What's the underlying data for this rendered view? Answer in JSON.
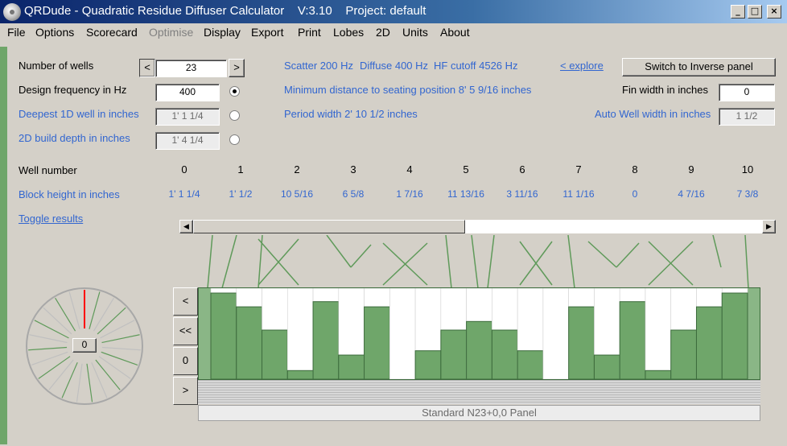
{
  "window": {
    "title": "QRDude - Quadratic Residue Diffuser Calculator    V:3.10    Project: default",
    "controls": [
      "_",
      "□",
      "×"
    ]
  },
  "menu": [
    "File",
    "Options",
    "Scorecard",
    "Optimise",
    "Display",
    "Export",
    "Print",
    "Lobes",
    "2D",
    "Units",
    "About"
  ],
  "menu_disabled": "Optimise",
  "form": {
    "num_wells_label": "Number of wells",
    "num_wells_value": "23",
    "design_freq_label": "Design frequency in Hz",
    "design_freq_value": "400",
    "deepest_label": "Deepest 1D well in inches",
    "deepest_value": "1' 1 1/4",
    "build_depth_label": "2D build depth in inches",
    "build_depth_value": "1' 4 1/4",
    "spin_left": "<",
    "spin_right": ">"
  },
  "info": {
    "scatter": "Scatter 200 Hz",
    "diffuse": "Diffuse 400 Hz",
    "hf_cutoff": "HF cutoff 4526 Hz",
    "explore": "< explore",
    "min_distance": "Minimum distance to seating position 8' 5 9/16 inches",
    "period_width": "Period width 2' 10 1/2 inches"
  },
  "right_panel": {
    "switch_button": "Switch to Inverse panel",
    "fin_label": "Fin width in inches",
    "fin_value": "0",
    "auto_well_label": "Auto Well width in inches",
    "auto_well_value": "1 1/2"
  },
  "table": {
    "well_number_label": "Well number",
    "block_height_label": "Block height in inches",
    "well_numbers": [
      "0",
      "1",
      "2",
      "3",
      "4",
      "5",
      "6",
      "7",
      "8",
      "9",
      "10"
    ],
    "block_heights": [
      "1' 1 1/4",
      "1' 1/2",
      "10 5/16",
      "6 5/8",
      "1 7/16",
      "11 13/16",
      "3 11/16",
      "11 1/16",
      "0",
      "4 7/16",
      "7 3/8"
    ]
  },
  "toggle_results": "Toggle results",
  "diffuser": {
    "block_heights_fraction": [
      1.0,
      0.84,
      0.57,
      0.1,
      0.9,
      0.28,
      0.84,
      0.0,
      0.33,
      0.57,
      0.67,
      0.57,
      0.33,
      0.0,
      0.84,
      0.28,
      0.9,
      0.1,
      0.57,
      0.84,
      1.0
    ],
    "fill_color": "#6fa66a",
    "panel_label": "Standard N23+0,0 Panel"
  },
  "side_buttons": [
    "<",
    "<<",
    "0",
    ">"
  ],
  "dial": {
    "center_label": "0",
    "pointer_color": "#ff0000"
  }
}
